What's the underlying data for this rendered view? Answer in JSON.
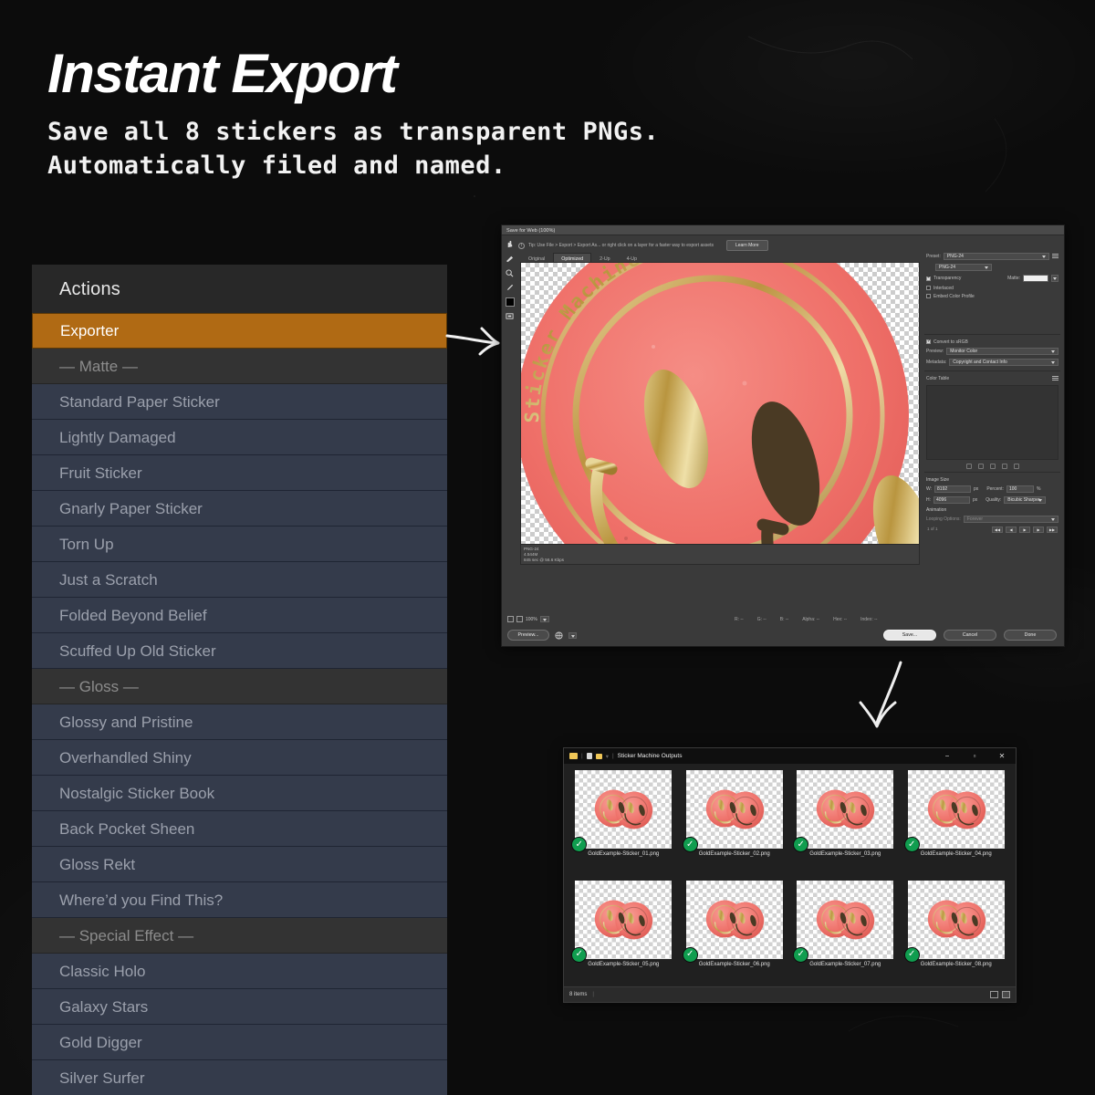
{
  "headline": "Instant Export",
  "subline": "Save all 8 stickers as transparent PNGs.\nAutomatically filed and named.",
  "colors": {
    "background": "#0c0c0c",
    "accent_selected": "#b06a14",
    "panel": "#282828",
    "row": "#343b4b",
    "check_green": "#109d4f"
  },
  "actions_panel": {
    "title": "Actions",
    "items": [
      {
        "label": "Exporter",
        "type": "action",
        "selected": true
      },
      {
        "label": "— Matte —",
        "type": "group"
      },
      {
        "label": "Standard Paper Sticker",
        "type": "action"
      },
      {
        "label": "Lightly Damaged",
        "type": "action"
      },
      {
        "label": "Fruit Sticker",
        "type": "action"
      },
      {
        "label": "Gnarly Paper Sticker",
        "type": "action"
      },
      {
        "label": "Torn Up",
        "type": "action"
      },
      {
        "label": "Just a Scratch",
        "type": "action"
      },
      {
        "label": "Folded Beyond Belief",
        "type": "action"
      },
      {
        "label": "Scuffed Up Old Sticker",
        "type": "action"
      },
      {
        "label": "— Gloss —",
        "type": "group"
      },
      {
        "label": "Glossy and Pristine",
        "type": "action"
      },
      {
        "label": "Overhandled Shiny",
        "type": "action"
      },
      {
        "label": "Nostalgic Sticker Book",
        "type": "action"
      },
      {
        "label": "Back Pocket Sheen",
        "type": "action"
      },
      {
        "label": "Gloss Rekt",
        "type": "action"
      },
      {
        "label": "Where’d you Find This?",
        "type": "action"
      },
      {
        "label": "— Special Effect —",
        "type": "group"
      },
      {
        "label": "Classic Holo",
        "type": "action"
      },
      {
        "label": "Galaxy Stars",
        "type": "action"
      },
      {
        "label": "Gold Digger",
        "type": "action"
      },
      {
        "label": "Silver Surfer",
        "type": "action"
      }
    ]
  },
  "save_for_web": {
    "title": "Save for Web (100%)",
    "tip": "Tip: Use File > Export > Export As... or right click on a layer for a faster way to export assets",
    "learn_more": "Learn More",
    "tabs": [
      "Original",
      "Optimized",
      "2-Up",
      "4-Up"
    ],
    "active_tab": "Optimized",
    "tools": [
      "hand-tool",
      "slice-select-tool",
      "zoom-tool",
      "eyedropper-tool",
      "foreground-color-swatch",
      "toggle-slices-visibility"
    ],
    "info": {
      "format": "PNG-24",
      "filesize": "4.544M",
      "speed": "845 sec @ 56.6 Kbps"
    },
    "settings": {
      "preset_label": "Preset:",
      "preset_value": "PNG-24",
      "format_value": "PNG-24",
      "transparency_label": "Transparency",
      "transparency_checked": true,
      "interlaced_label": "Interlaced",
      "interlaced_checked": false,
      "embed_color_profile_label": "Embed Color Profile",
      "embed_color_profile_checked": false,
      "matte_label": "Matte:",
      "matte_value": "",
      "convert_srgb_label": "Convert to sRGB",
      "convert_srgb_checked": true,
      "preview_label": "Preview:",
      "preview_value": "Monitor Color",
      "metadata_label": "Metadata:",
      "metadata_value": "Copyright and Contact Info",
      "color_table_label": "Color Table"
    },
    "image_size": {
      "title": "Image Size",
      "w_label": "W:",
      "w_value": "8192",
      "h_label": "H:",
      "h_value": "4096",
      "unit": "px",
      "percent_label": "Percent:",
      "percent_value": "100",
      "percent_unit": "%",
      "quality_label": "Quality:",
      "quality_value": "Bicubic Sharper"
    },
    "animation": {
      "title": "Animation",
      "looping_label": "Looping Options:",
      "looping_value": "Forever",
      "frame_counter": "1 of 1"
    },
    "zoom_value": "100%",
    "eyedropper_readout": [
      "R: --",
      "G: --",
      "B: --",
      "Alpha: --",
      "Hex: --",
      "Index: --"
    ],
    "preview_button": "Preview...",
    "buttons": {
      "save": "Save...",
      "cancel": "Cancel",
      "done": "Done"
    }
  },
  "explorer": {
    "title": "Sticker Machine Outputs",
    "window_controls": [
      "minimize",
      "maximize",
      "close"
    ],
    "status": "8 items",
    "files": [
      "GoldExample-Sticker_01.png",
      "GoldExample-Sticker_02.png",
      "GoldExample-Sticker_03.png",
      "GoldExample-Sticker_04.png",
      "GoldExample-Sticker_05.png",
      "GoldExample-Sticker_06.png",
      "GoldExample-Sticker_07.png",
      "GoldExample-Sticker_08.png"
    ]
  },
  "sticker": {
    "ring_text": "Sticker Machine and ... that life cha ... oth that is",
    "body_color": "#f0736e",
    "foil_color": "#c9a84a",
    "ink_color": "#4a3a24"
  }
}
